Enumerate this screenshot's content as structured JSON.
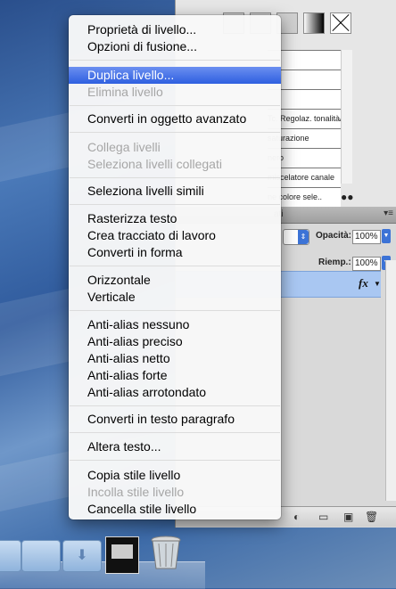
{
  "context_menu": {
    "items": [
      {
        "label": "Proprietà di livello...",
        "enabled": true
      },
      {
        "label": "Opzioni di fusione...",
        "enabled": true
      },
      {
        "label": "Duplica livello...",
        "enabled": true,
        "highlighted": true
      },
      {
        "label": "Elimina livello",
        "enabled": false
      },
      {
        "label": "Converti in oggetto avanzato",
        "enabled": true
      },
      {
        "label": "Collega livelli",
        "enabled": false
      },
      {
        "label": "Seleziona livelli collegati",
        "enabled": false
      },
      {
        "label": "Seleziona livelli simili",
        "enabled": true
      },
      {
        "label": "Rasterizza testo",
        "enabled": true
      },
      {
        "label": "Crea tracciato di lavoro",
        "enabled": true
      },
      {
        "label": "Converti in forma",
        "enabled": true
      },
      {
        "label": "Orizzontale",
        "enabled": true
      },
      {
        "label": "Verticale",
        "enabled": true
      },
      {
        "label": "Anti-alias nessuno",
        "enabled": true
      },
      {
        "label": "Anti-alias preciso",
        "enabled": true
      },
      {
        "label": "Anti-alias netto",
        "enabled": true
      },
      {
        "label": "Anti-alias forte",
        "enabled": true
      },
      {
        "label": "Anti-alias arrotondato",
        "enabled": true
      },
      {
        "label": "Converti in testo paragrafo",
        "enabled": true
      },
      {
        "label": "Altera testo...",
        "enabled": true
      },
      {
        "label": "Copia stile livello",
        "enabled": true
      },
      {
        "label": "Incolla stile livello",
        "enabled": false
      },
      {
        "label": "Cancella stile livello",
        "enabled": true
      }
    ],
    "highlight_color": "#3d6be6"
  },
  "adjustments_panel": {
    "rows": [
      "",
      "",
      "",
      "Tc. Regolaz. tonalità/saturazione",
      "saturazione",
      "nero",
      "miscelatore canale",
      "ne colore sele.."
    ]
  },
  "layers_panel": {
    "tab_label": "ati",
    "opacity_label": "Opacità:",
    "opacity_value": "100%",
    "fill_label": "Riemp.:",
    "fill_value": "100%",
    "layer_fx_label": "fx"
  }
}
